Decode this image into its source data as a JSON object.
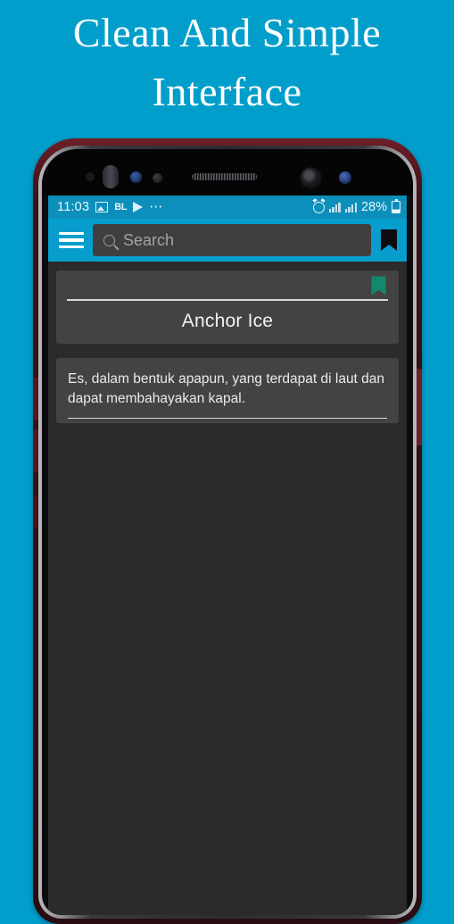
{
  "promo": {
    "headline": "Clean And Simple\nInterface"
  },
  "colors": {
    "background_cyan": "#029ECB",
    "toolbar_cyan": "#079DCD",
    "statusbar_cyan": "#0C8FBA",
    "screen_dark": "#2B2B2B",
    "card_dark": "#434343",
    "bookmark_green": "#13886E",
    "text_white": "#F2F2F2"
  },
  "statusbar": {
    "time": "11:03",
    "battery_percent": "28%",
    "left_icons": [
      "photo-icon",
      "bl-badge",
      "play-icon",
      "overflow-dots-icon"
    ],
    "bl_label": "BL",
    "overflow_dots": "⋯",
    "right_icons": [
      "alarm-icon",
      "signal-bars-icon",
      "signal-bars-icon",
      "battery-icon"
    ]
  },
  "toolbar": {
    "menu_icon": "hamburger-menu-icon",
    "search": {
      "placeholder": "Search",
      "value": "",
      "icon": "search-icon"
    },
    "bookmark_icon": "bookmark-icon"
  },
  "entry": {
    "bookmark_icon": "bookmark-filled-icon",
    "bookmark_active": true,
    "title": "Anchor Ice",
    "definition": "Es, dalam bentuk apapun, yang terdapat di laut dan dapat membahayakan kapal."
  },
  "device": {
    "sensors": [
      "proximity-sensor",
      "iris-scanner",
      "front-camera-sensor",
      "light-sensor",
      "earpiece-speaker",
      "front-camera",
      "notification-led"
    ],
    "buttons": [
      "volume-up-button",
      "volume-down-button",
      "bixby-button",
      "power-button"
    ]
  }
}
